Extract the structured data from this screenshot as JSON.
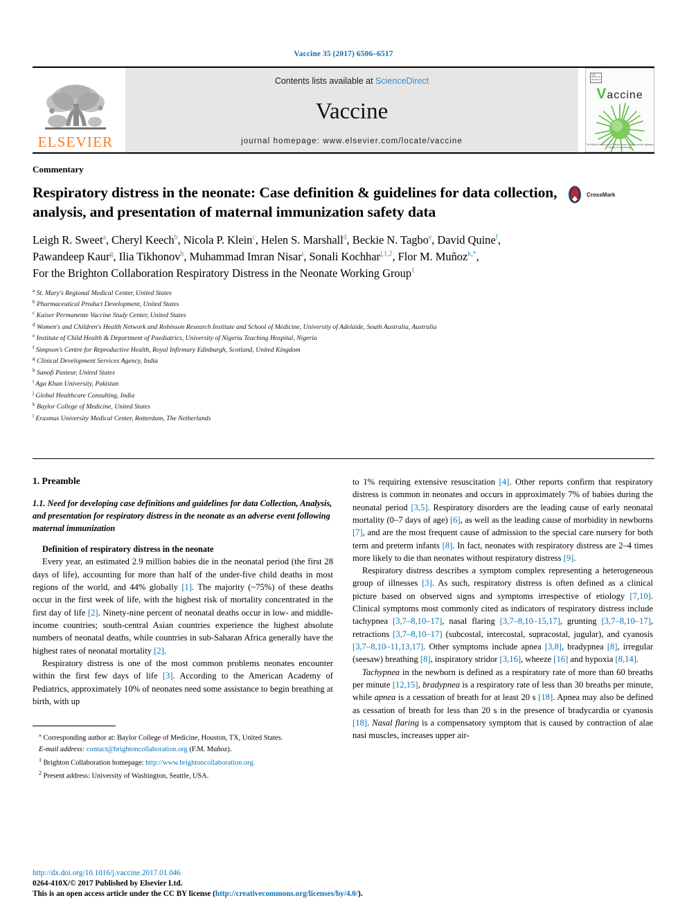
{
  "running_head": "Vaccine 35 (2017) 6506–6517",
  "masthead": {
    "publisher_logo_text": "ELSEVIER",
    "contents_prefix": "Contents lists available at ",
    "contents_link": "ScienceDirect",
    "journal_name": "Vaccine",
    "homepage_line": "journal homepage: www.elsevier.com/locate/vaccine",
    "cover": {
      "badge_text": "THE OFFICIAL JOURNAL",
      "title_first_letter": "V",
      "title_rest": "accine",
      "caption": "The Official Journal for the Edward Jenner Society and the Japanese Society for Vaccinology"
    }
  },
  "article": {
    "type": "Commentary",
    "title": "Respiratory distress in the neonate: Case definition & guidelines for data collection, analysis, and presentation of maternal immunization safety data",
    "crossmark_label": "CrossMark",
    "authors_line1": "Leigh R. Sweet a, Cheryl Keech b, Nicola P. Klein c, Helen S. Marshall d, Beckie N. Tagbo e, David Quine f,",
    "authors_line2": "Pawandeep Kaur g, Ilia Tikhonov h, Muhammad Imran Nisar i, Sonali Kochhar j,1,2, Flor M. Muñoz k,*,",
    "authors_line3": "For the Brighton Collaboration Respiratory Distress in the Neonate Working Group 1",
    "authors": [
      {
        "name": "Leigh R. Sweet",
        "sup": "a",
        "sep": ", "
      },
      {
        "name": "Cheryl Keech",
        "sup": "b",
        "sep": ", "
      },
      {
        "name": "Nicola P. Klein",
        "sup": "c",
        "sep": ", "
      },
      {
        "name": "Helen S. Marshall",
        "sup": "d",
        "sep": ", "
      },
      {
        "name": "Beckie N. Tagbo",
        "sup": "e",
        "sep": ", "
      },
      {
        "name": "David Quine",
        "sup": "f",
        "sep": ", "
      },
      {
        "name": "Pawandeep Kaur",
        "sup": "g",
        "sep": ", "
      },
      {
        "name": "Ilia Tikhonov",
        "sup": "h",
        "sep": ", "
      },
      {
        "name": "Muhammad Imran Nisar",
        "sup": "i",
        "sep": ", "
      },
      {
        "name": "Sonali Kochhar",
        "sup": "j,1,2",
        "sep": ", "
      },
      {
        "name": "Flor M. Muñoz",
        "sup": "k,*",
        "sep": ", "
      }
    ],
    "group_author": "For the Brighton Collaboration Respiratory Distress in the Neonate Working Group",
    "group_author_sup": "1",
    "affiliations": [
      {
        "mark": "a",
        "text": "St. Mary's Regional Medical Center, United States"
      },
      {
        "mark": "b",
        "text": "Pharmaceutical Product Development, United States"
      },
      {
        "mark": "c",
        "text": "Kaiser Permanente Vaccine Study Center, United States"
      },
      {
        "mark": "d",
        "text": "Women's and Children's Health Network and Robinson Research Institute and School of Medicine, University of Adelaide, South Australia, Australia"
      },
      {
        "mark": "e",
        "text": "Institute of Child Health & Department of Paediatrics, University of Nigeria Teaching Hospital, Nigeria"
      },
      {
        "mark": "f",
        "text": "Simpson's Centre for Reproductive Health, Royal Infirmary Edinburgh, Scotland, United Kingdom"
      },
      {
        "mark": "g",
        "text": "Clinical Development Services Agency, India"
      },
      {
        "mark": "h",
        "text": "Sanofi Pasteur, United States"
      },
      {
        "mark": "i",
        "text": "Aga Khan University, Pakistan"
      },
      {
        "mark": "j",
        "text": "Global Healthcare Consulting, India"
      },
      {
        "mark": "k",
        "text": "Baylor College of Medicine, United States"
      },
      {
        "mark": "l",
        "text": "Erasmus University Medical Center, Rotterdam, The Netherlands"
      }
    ]
  },
  "left_column": {
    "section_number_title": "1. Preamble",
    "subsection": "1.1. Need for developing case definitions and guidelines for data Collection, Analysis, and presentation for respiratory distress in the neonate as an adverse event following maternal immunization",
    "runin_heading": "Definition of respiratory distress in the neonate",
    "paragraph_1": "Every year, an estimated 2.9 million babies die in the neonatal period (the first 28 days of life), accounting for more than half of the under-five child deaths in most regions of the world, and 44% globally [1]. The majority (~75%) of these deaths occur in the first week of life, with the highest risk of mortality concentrated in the first day of life [2]. Ninety-nine percent of neonatal deaths occur in low- and middle-income countries; south-central Asian countries experience the highest absolute numbers of neonatal deaths, while countries in sub-Saharan Africa generally have the highest rates of neonatal mortality [2].",
    "paragraph_2": "Respiratory distress is one of the most common problems neonates encounter within the first few days of life [3]. According to the American Academy of Pediatrics, approximately 10% of neonates need some assistance to begin breathing at birth, with up"
  },
  "right_column": {
    "paragraph_1": "to 1% requiring extensive resuscitation [4]. Other reports confirm that respiratory distress is common in neonates and occurs in approximately 7% of babies during the neonatal period [3,5]. Respiratory disorders are the leading cause of early neonatal mortality (0–7 days of age) [6], as well as the leading cause of morbidity in newborns [7], and are the most frequent cause of admission to the special care nursery for both term and preterm infants [8]. In fact, neonates with respiratory distress are 2–4 times more likely to die than neonates without respiratory distress [9].",
    "paragraph_2": "Respiratory distress describes a symptom complex representing a heterogeneous group of illnesses [3]. As such, respiratory distress is often defined as a clinical picture based on observed signs and symptoms irrespective of etiology [7,10]. Clinical symptoms most commonly cited as indicators of respiratory distress include tachypnea [3,7–8,10–17], nasal flaring [3,7–8,10–15,17], grunting [3,7–8,10–17], retractions [3,7–8,10–17] (subcostal, intercostal, supracostal, jugular), and cyanosis [3,7–8,10–11,13,17]. Other symptoms include apnea [3,8], bradypnea [8], irregular (seesaw) breathing [8], inspiratory stridor [3,16], wheeze [16] and hypoxia [8,14].",
    "paragraph_3": "Tachypnea in the newborn is defined as a respiratory rate of more than 60 breaths per minute [12,15], bradypnea is a respiratory rate of less than 30 breaths per minute, while apnea is a cessation of breath for at least 20 s [18]. Apnea may also be defined as cessation of breath for less than 20 s in the presence of bradycardia or cyanosis [18]. Nasal flaring is a compensatory symptom that is caused by contraction of alae nasi muscles, increases upper air-"
  },
  "footnotes": {
    "corresponding_mark": "⁎",
    "corresponding_text": "Corresponding author at: Baylor College of Medicine, Houston, TX, United States.",
    "email_label": "E-mail address:",
    "email_link": "contact@brightoncollaboration.org",
    "email_suffix": "(F.M. Muñoz).",
    "note1_mark": "1",
    "note1_label": "Brighton Collaboration homepage:",
    "note1_link": "http://www.brightoncollaboration.org.",
    "note2_mark": "2",
    "note2_text": "Present address: University of Washington, Seattle, USA."
  },
  "page_footer": {
    "doi": "http://dx.doi.org/10.1016/j.vaccine.2017.01.046",
    "copyright": "0264-410X/© 2017 Published by Elsevier Ltd.",
    "license_prefix": "This is an open access article under the CC BY license (",
    "license_link": "http://creativecommons.org/licenses/by/4.0/",
    "license_suffix": ")."
  },
  "colors": {
    "link_blue": "#0b72b5",
    "sciencedirect_blue": "#2d8fd5",
    "elsevier_orange": "#f57c20",
    "masthead_gray": "#e6e6e6",
    "vaccine_green": "#56b948",
    "crossmark_red": "#b4272c",
    "crossmark_navy": "#2c3e6b"
  }
}
